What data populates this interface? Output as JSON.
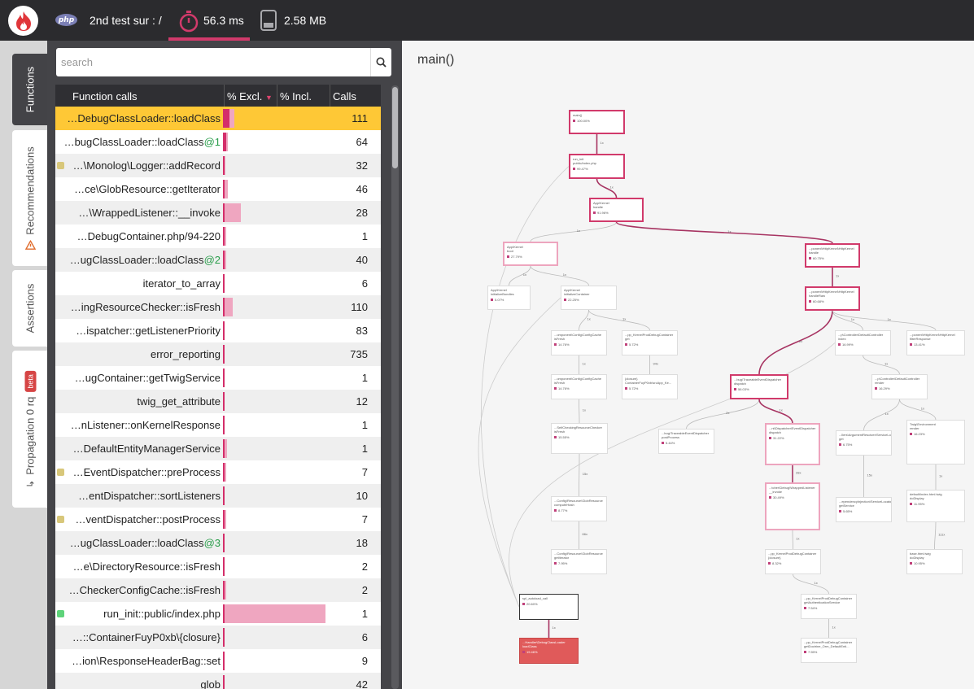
{
  "header": {
    "php_badge": "php",
    "title": "2nd test sur : /",
    "time": "56.3 ms",
    "memory": "2.58 MB"
  },
  "tabs": [
    {
      "label": "Functions"
    },
    {
      "label": "Recommendations"
    },
    {
      "label": "Assertions"
    },
    {
      "label": "Propagation 0 rq",
      "badge": "beta"
    }
  ],
  "search": {
    "placeholder": "search"
  },
  "table": {
    "columns": [
      "Function calls",
      "% Excl.",
      "% Incl.",
      "Calls"
    ],
    "rows": [
      {
        "fn": "…DebugClassLoader::loadClass",
        "suffix": "",
        "calls": "111",
        "excl": 0.06,
        "incl": 0.1,
        "dot": ""
      },
      {
        "fn": "…bugClassLoader::loadClass",
        "suffix": "@1",
        "calls": "64",
        "excl": 0.025,
        "incl": 0.04,
        "dot": ""
      },
      {
        "fn": "…\\Monolog\\Logger::addRecord",
        "suffix": "",
        "calls": "32",
        "excl": 0.012,
        "incl": 0.02,
        "dot": "#d8c77a"
      },
      {
        "fn": "…ce\\GlobResource::getIterator",
        "suffix": "",
        "calls": "46",
        "excl": 0.012,
        "incl": 0.04,
        "dot": ""
      },
      {
        "fn": "…\\WrappedListener::__invoke",
        "suffix": "",
        "calls": "28",
        "excl": 0.01,
        "incl": 0.155,
        "dot": ""
      },
      {
        "fn": "…DebugContainer.php/94-220",
        "suffix": "",
        "calls": "1",
        "excl": 0.01,
        "incl": 0.025,
        "dot": ""
      },
      {
        "fn": "…ugClassLoader::loadClass",
        "suffix": "@2",
        "calls": "40",
        "excl": 0.01,
        "incl": 0.025,
        "dot": ""
      },
      {
        "fn": "iterator_to_array",
        "suffix": "",
        "calls": "6",
        "excl": 0.01,
        "incl": 0.01,
        "dot": ""
      },
      {
        "fn": "…ingResourceChecker::isFresh",
        "suffix": "",
        "calls": "110",
        "excl": 0.01,
        "incl": 0.085,
        "dot": ""
      },
      {
        "fn": "…ispatcher::getListenerPriority",
        "suffix": "",
        "calls": "83",
        "excl": 0.01,
        "incl": 0.01,
        "dot": ""
      },
      {
        "fn": "error_reporting",
        "suffix": "",
        "calls": "735",
        "excl": 0.01,
        "incl": 0.01,
        "dot": ""
      },
      {
        "fn": "…ugContainer::getTwigService",
        "suffix": "",
        "calls": "1",
        "excl": 0.005,
        "incl": 0.01,
        "dot": ""
      },
      {
        "fn": "twig_get_attribute",
        "suffix": "",
        "calls": "12",
        "excl": 0.01,
        "incl": 0.01,
        "dot": ""
      },
      {
        "fn": "…nListener::onKernelResponse",
        "suffix": "",
        "calls": "1",
        "excl": 0.005,
        "incl": 0.005,
        "dot": ""
      },
      {
        "fn": "…DefaultEntityManagerService",
        "suffix": "",
        "calls": "1",
        "excl": 0.005,
        "incl": 0.035,
        "dot": ""
      },
      {
        "fn": "…EventDispatcher::preProcess",
        "suffix": "",
        "calls": "7",
        "excl": 0.01,
        "incl": 0.025,
        "dot": "#d8c77a"
      },
      {
        "fn": "…entDispatcher::sortListeners",
        "suffix": "",
        "calls": "10",
        "excl": 0.005,
        "incl": 0.005,
        "dot": ""
      },
      {
        "fn": "…ventDispatcher::postProcess",
        "suffix": "",
        "calls": "7",
        "excl": 0.01,
        "incl": 0.025,
        "dot": "#d8c77a"
      },
      {
        "fn": "…ugClassLoader::loadClass",
        "suffix": "@3",
        "calls": "18",
        "excl": 0.005,
        "incl": 0.01,
        "dot": ""
      },
      {
        "fn": "…e\\DirectoryResource::isFresh",
        "suffix": "",
        "calls": "2",
        "excl": 0.005,
        "incl": 0.005,
        "dot": ""
      },
      {
        "fn": "…CheckerConfigCache::isFresh",
        "suffix": "",
        "calls": "2",
        "excl": 0.005,
        "incl": 0.03,
        "dot": ""
      },
      {
        "fn": "run_init::public/index.php",
        "suffix": "",
        "calls": "1",
        "excl": 0.003,
        "incl": 0.9,
        "dot": "#5ed37a"
      },
      {
        "fn": "…::ContainerFuyP0xb\\{closure}",
        "suffix": "",
        "calls": "6",
        "excl": 0.005,
        "incl": 0.005,
        "dot": ""
      },
      {
        "fn": "…ion\\ResponseHeaderBag::set",
        "suffix": "",
        "calls": "9",
        "excl": 0.005,
        "incl": 0.005,
        "dot": ""
      },
      {
        "fn": "glob",
        "suffix": "",
        "calls": "42",
        "excl": 0.005,
        "incl": 0.005,
        "dot": ""
      }
    ]
  },
  "graph": {
    "title": "main()",
    "nodes": [
      {
        "id": "main",
        "lines": [
          "main()"
        ],
        "pct": "100.00%",
        "style": "hot"
      },
      {
        "id": "run_init",
        "lines": [
          "run_init",
          "public/index.php"
        ],
        "pct": "99.47%",
        "style": "hot"
      },
      {
        "id": "kernel_handle",
        "lines": [
          "App\\Kernel",
          "handle"
        ],
        "pct": "91.96%",
        "style": "hot"
      },
      {
        "id": "kernel_boot",
        "lines": [
          "App\\Kernel",
          "boot"
        ],
        "pct": "27.79%",
        "style": "warm"
      },
      {
        "id": "httpkernel_handle",
        "lines": [
          "...ponent\\HttpKernel\\HttpKernel",
          "handle"
        ],
        "pct": "60.75%",
        "style": "hot"
      },
      {
        "id": "init_bundles",
        "lines": [
          "App\\Kernel",
          "initializeBundles"
        ],
        "pct": "5.07%",
        "style": "plain"
      },
      {
        "id": "init_container",
        "lines": [
          "App\\Kernel",
          "initializeContainer"
        ],
        "pct": "22.25%",
        "style": "plain"
      },
      {
        "id": "handle_raw",
        "lines": [
          "...ponent\\HttpKernel\\HttpKernel",
          "handleRaw"
        ],
        "pct": "60.68%",
        "style": "hot"
      },
      {
        "id": "configcache_isfresh",
        "lines": [
          "...omponent\\Config\\ConfigCache",
          "isFresh"
        ],
        "pct": "14.76%",
        "style": "plain"
      },
      {
        "id": "kernelprod_get",
        "lines": [
          "...pp_KernelProdDebugContainer",
          "get"
        ],
        "pct": "5.72%",
        "style": "plain"
      },
      {
        "id": "default_index",
        "lines": [
          "...p\\Controller\\DefaultController",
          "index"
        ],
        "pct": "16.99%",
        "style": "plain"
      },
      {
        "id": "filter_response",
        "lines": [
          "...ponent\\HttpKernel\\HttpKernel",
          "filterResponse"
        ],
        "pct": "13.41%",
        "style": "plain"
      },
      {
        "id": "configcache_isfresh2",
        "lines": [
          "...omponent\\Config\\ConfigCache",
          "isFresh"
        ],
        "pct": "14.76%",
        "style": "plain"
      },
      {
        "id": "closure",
        "lines": [
          "{closure}",
          "ContainerFuyP0xb\\srcApp_Ke..."
        ],
        "pct": "5.72%",
        "style": "plain"
      },
      {
        "id": "traceable_dispatch",
        "lines": [
          "...bug\\TraceableEventDispatcher",
          "dispatch"
        ],
        "pct": "56.03%",
        "style": "hot"
      },
      {
        "id": "default_render",
        "lines": [
          "...p\\Controller\\DefaultController",
          "render"
        ],
        "pct": "16.29%",
        "style": "plain"
      },
      {
        "id": "resource_checker",
        "lines": [
          "...SelfCheckingResourceChecker",
          "isFresh"
        ],
        "pct": "15.55%",
        "style": "plain"
      },
      {
        "id": "post_process",
        "lines": [
          "...bug\\TraceableEventDispatcher",
          "postProcess"
        ],
        "pct": "5.44%",
        "style": "plain"
      },
      {
        "id": "event_dispatch",
        "lines": [
          "...nt\\Dispatcher\\EventDispatcher",
          "dispatch"
        ],
        "pct": "31.22%",
        "style": "warm"
      },
      {
        "id": "service_locator",
        "lines": [
          "...llers\\ArgumentResolver\\ServiceLocator",
          "get"
        ],
        "pct": "6.75%",
        "style": "plain"
      },
      {
        "id": "twig_render",
        "lines": [
          "Twig\\Environment",
          "render"
        ],
        "pct": "16.23%",
        "style": "plain"
      },
      {
        "id": "glob_resource",
        "lines": [
          "...Config\\Resource\\GlobResource",
          "computeHash"
        ],
        "pct": "8.77%",
        "style": "plain"
      },
      {
        "id": "wrapped_listener",
        "lines": [
          "...tcher\\Debug\\WrappedListener",
          "__invoke"
        ],
        "pct": "30.49%",
        "style": "warm"
      },
      {
        "id": "get_service",
        "lines": [
          "...ependencyInjection\\ServiceLocator",
          "getService"
        ],
        "pct": "5.65%",
        "style": "plain"
      },
      {
        "id": "do_display",
        "lines": [
          "default/index.html.twig",
          "doDisplay"
        ],
        "pct": "11.95%",
        "style": "plain"
      },
      {
        "id": "glob_iterator",
        "lines": [
          "...Config\\Resource\\GlobResource",
          "getIterator"
        ],
        "pct": "7.95%",
        "style": "plain"
      },
      {
        "id": "container_closure",
        "lines": [
          "...pp_KernelProdDebugContainer",
          "{closure}"
        ],
        "pct": "8.32%",
        "style": "plain"
      },
      {
        "id": "base_twig",
        "lines": [
          "base.html.twig",
          "doDisplay"
        ],
        "pct": "10.95%",
        "style": "plain"
      },
      {
        "id": "spl_autoload",
        "lines": [
          "spl_autoload_call"
        ],
        "pct": "20.60%",
        "style": "black"
      },
      {
        "id": "auth_service",
        "lines": [
          "...pp_KernelProdDebugContainer",
          "getAuthenticationService"
        ],
        "pct": "7.54%",
        "style": "plain"
      },
      {
        "id": "debug_loadclass",
        "lines": [
          "...Handler\\DebugClassLoader",
          "loadClass"
        ],
        "pct": "19.46%",
        "style": "red"
      },
      {
        "id": "doctrine_service",
        "lines": [
          "...pp_KernelProdDebugContainer",
          "getDoctrine_Orm_DefaultEnti..."
        ],
        "pct": "7.55%",
        "style": "plain"
      }
    ],
    "edge_labels": [
      "1x",
      "1x",
      "1x",
      "1x",
      "1x",
      "1x",
      "1x",
      "1x",
      "1x",
      "1x",
      "2x",
      "1x",
      "1x",
      "94x",
      "1x",
      "2x",
      "1x",
      "1x",
      "1x",
      "1x",
      "15x",
      "28x",
      "15x",
      "1x",
      "66x",
      "1x",
      "111x",
      "1x",
      "1x",
      "1x"
    ]
  }
}
